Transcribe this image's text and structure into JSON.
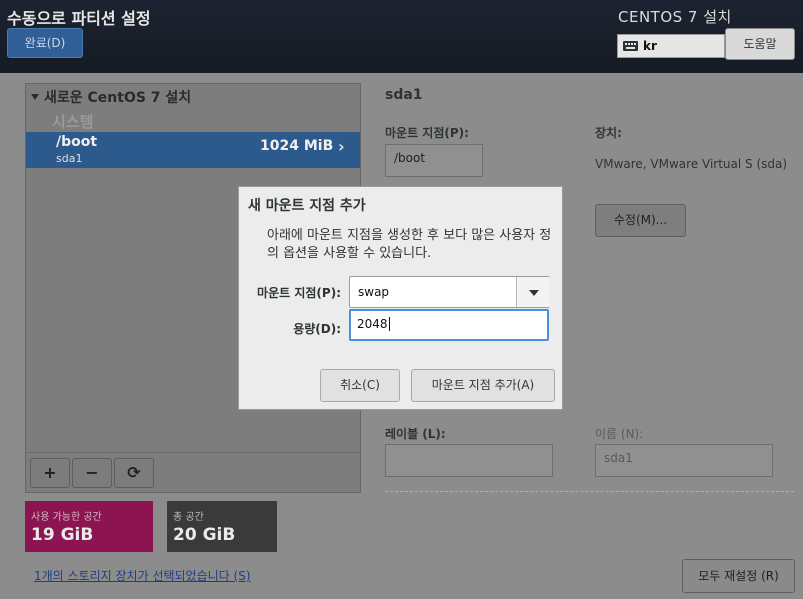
{
  "header": {
    "title": "수동으로 파티션 설정",
    "done_label": "완료(D)",
    "product": "CENTOS 7 설치",
    "keyboard_layout": "kr",
    "help_label": "도움말"
  },
  "left": {
    "tree_title": "새로운 CentOS 7 설치",
    "group_label": "시스템",
    "partitions": [
      {
        "name": "/boot",
        "device": "sda1",
        "size": "1024 MiB"
      }
    ],
    "toolbar": {
      "add": "+",
      "remove": "−",
      "refresh": "⟳"
    }
  },
  "space": {
    "available_label": "사용 가능한 공간",
    "available_value": "19 GiB",
    "total_label": "총 공간",
    "total_value": "20 GiB"
  },
  "storage_link": "1개의 스토리지 장치가 선택되었습니다 (S)",
  "right": {
    "partition_title": "sda1",
    "mount_label": "마운트 지점(P):",
    "mount_value": "/boot",
    "device_label": "장치:",
    "device_value": "VMware, VMware Virtual S (sda)",
    "modify_label": "수정(M)...",
    "label_label": "레이블 (L):",
    "label_value": "",
    "name_label": "이름 (N):",
    "name_value": "sda1",
    "reset_label": "모두 재설정 (R)"
  },
  "dialog": {
    "title": "새 마운트 지점 추가",
    "description": "아래에 마운트 지점을 생성한 후 보다 많은 사용자 정의 옵션을 사용할 수 있습니다.",
    "mount_label": "마운트 지점(P):",
    "mount_value": "swap",
    "capacity_label": "용량(D):",
    "capacity_value": "2048",
    "cancel_label": "취소(C)",
    "add_label": "마운트 지점 추가(A)"
  },
  "colors": {
    "header_bg": "#1d2330",
    "selected_row": "#2d5a8d",
    "available_space": "#8c1450",
    "focus_border": "#4a90d9"
  }
}
